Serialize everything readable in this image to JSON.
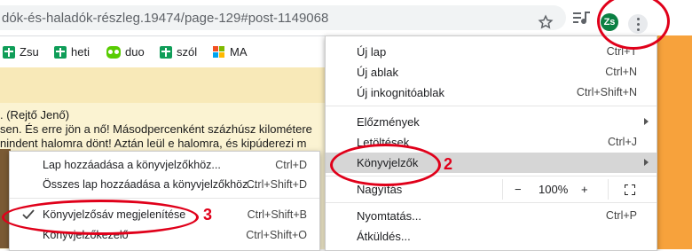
{
  "address_bar": {
    "url": "dók-és-haladók-részleg.19474/page-129#post-1149068",
    "avatar_initials": "Zs"
  },
  "bookmarks": [
    {
      "label": "Zsu",
      "icon": "green-cross-icon"
    },
    {
      "label": "heti",
      "icon": "green-cross-icon"
    },
    {
      "label": "duo",
      "icon": "owl-icon"
    },
    {
      "label": "szól",
      "icon": "green-cross-icon"
    },
    {
      "label": "MA",
      "icon": "windows-logo-icon"
    }
  ],
  "page": {
    "lines": [
      ". (Rejtő Jenő)",
      "sen. És erre jön a nő! Másodpercenként százhúsz kilométere",
      "nindent halomra dönt! Aztán leül e halomra, és kipúderezi m"
    ]
  },
  "menu": {
    "new_tab": {
      "label": "Új lap",
      "shortcut": "Ctrl+T"
    },
    "new_window": {
      "label": "Új ablak",
      "shortcut": "Ctrl+N"
    },
    "incognito": {
      "label": "Új inkognitóablak",
      "shortcut": "Ctrl+Shift+N"
    },
    "history": {
      "label": "Előzmények"
    },
    "downloads": {
      "label": "Letöltések",
      "shortcut": "Ctrl+J"
    },
    "bookmarks": {
      "label": "Könyvjelzők"
    },
    "zoom": {
      "label": "Nagyítás",
      "minus": "−",
      "value": "100%",
      "plus": "+"
    },
    "print": {
      "label": "Nyomtatás...",
      "shortcut": "Ctrl+P"
    },
    "cast": {
      "label": "Átküldés..."
    }
  },
  "submenu": {
    "add_page": {
      "label": "Lap hozzáadása a könyvjelzőkhöz...",
      "shortcut": "Ctrl+D"
    },
    "add_all": {
      "label": "Összes lap hozzáadása a könyvjelzőkhöz...",
      "shortcut": "Ctrl+Shift+D"
    },
    "show_bar": {
      "label": "Könyvjelzősáv megjelenítése",
      "shortcut": "Ctrl+Shift+B"
    },
    "manager": {
      "label": "Könyvjelzőkezelő",
      "shortcut": "Ctrl+Shift+O"
    }
  },
  "annotations": {
    "step2": "2",
    "step3": "3"
  },
  "colors": {
    "annotation": "#e0001a",
    "highlight": "#d6d6d6",
    "page_bg": "#fbf3d2"
  }
}
